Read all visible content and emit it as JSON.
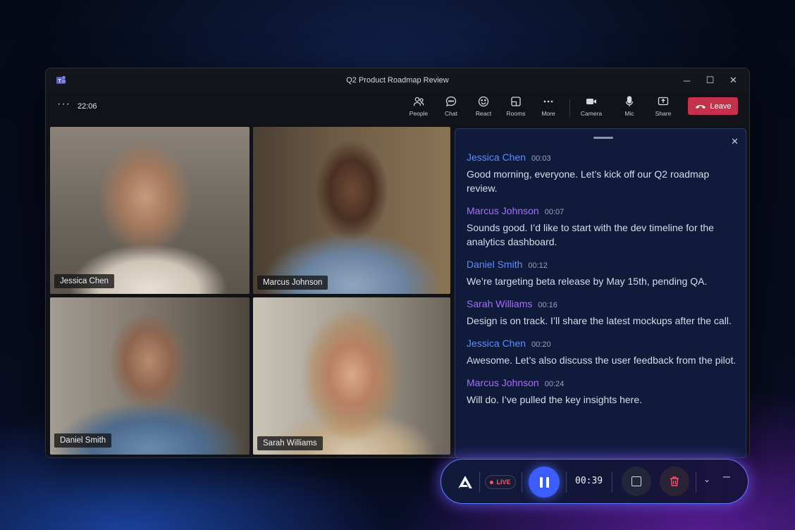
{
  "window": {
    "title": "Q2 Product Roadmap Review",
    "controls": {
      "minimize": "─",
      "maximize": "☐",
      "close": "✕"
    }
  },
  "toolbar": {
    "more_dots": "···",
    "time": "22:06",
    "tools": [
      {
        "icon": "people-icon",
        "label": "People"
      },
      {
        "icon": "chat-icon",
        "label": "Chat"
      },
      {
        "icon": "react-icon",
        "label": "React"
      },
      {
        "icon": "rooms-icon",
        "label": "Rooms"
      },
      {
        "icon": "more-icon",
        "label": "More"
      },
      {
        "icon": "camera-icon",
        "label": "Camera"
      },
      {
        "icon": "mic-icon",
        "label": "Mic"
      },
      {
        "icon": "share-icon",
        "label": "Share"
      }
    ],
    "leave_label": "Leave"
  },
  "participants": [
    {
      "name": "Jessica Chen"
    },
    {
      "name": "Marcus Johnson"
    },
    {
      "name": "Daniel Smith"
    },
    {
      "name": "Sarah Williams"
    }
  ],
  "transcript": {
    "close": "✕",
    "entries": [
      {
        "speaker": "Jessica Chen",
        "time": "00:03",
        "text": "Good morning, everyone. Let’s kick off our Q2 roadmap review.",
        "color": "#5b8cff"
      },
      {
        "speaker": "Marcus Johnson",
        "time": "00:07",
        "text": "Sounds good. I’d like to start with the dev timeline for the analytics dashboard.",
        "color": "#a86bff"
      },
      {
        "speaker": "Daniel Smith",
        "time": "00:12",
        "text": "We’re targeting beta release by May 15th, pending QA.",
        "color": "#5b8cff"
      },
      {
        "speaker": "Sarah Williams",
        "time": "00:16",
        "text": "Design is on track. I’ll share the latest mockups after the call.",
        "color": "#a86bff"
      },
      {
        "speaker": "Jessica Chen",
        "time": "00:20",
        "text": "Awesome. Let’s also discuss the user feedback from the pilot.",
        "color": "#5b8cff"
      },
      {
        "speaker": "Marcus Johnson",
        "time": "00:24",
        "text": "Will do. I’ve pulled the key insights here.",
        "color": "#a86bff"
      }
    ]
  },
  "recorder": {
    "live_label": "LIVE",
    "timer": "00:39",
    "chevron": "⌄",
    "minimize": "─"
  },
  "colors": {
    "accent": "#3b5cff",
    "leave": "#c4314b",
    "live": "#ff4f6d"
  }
}
